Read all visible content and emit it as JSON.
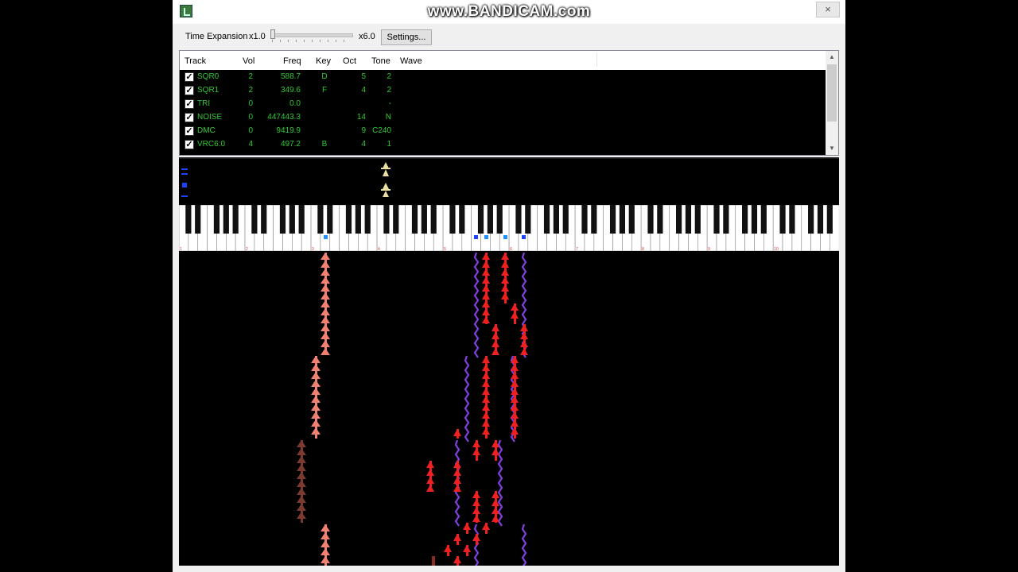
{
  "watermark": "www.BANDICAM.com",
  "window": {
    "close_glyph": "×",
    "icon": "app-note-icon"
  },
  "toolbar": {
    "time_expansion_label": "Time Expansion",
    "min_label": "x1.0",
    "max_label": "x6.0",
    "slider_value": 1.0,
    "settings_label": "Settings..."
  },
  "track_table": {
    "columns": [
      "Track",
      "Vol",
      "Freq",
      "Key",
      "Oct",
      "Tone",
      "Wave"
    ],
    "rows": [
      {
        "checked": true,
        "track": "SQR0",
        "vol": "2",
        "freq": "588.7",
        "key": "D",
        "oct": "5",
        "tone": "2"
      },
      {
        "checked": true,
        "track": "SQR1",
        "vol": "2",
        "freq": "349.6",
        "key": "F",
        "oct": "4",
        "tone": "2"
      },
      {
        "checked": true,
        "track": "TRI",
        "vol": "0",
        "freq": "0.0",
        "key": "",
        "oct": "",
        "tone": "-"
      },
      {
        "checked": true,
        "track": "NOISE",
        "vol": "0",
        "freq": "447443.3",
        "key": "",
        "oct": "14",
        "tone": "N"
      },
      {
        "checked": true,
        "track": "DMC",
        "vol": "0",
        "freq": "9419.9",
        "key": "",
        "oct": "9",
        "tone": "C240"
      },
      {
        "checked": true,
        "track": "VRC6:0",
        "vol": "4",
        "freq": "497.2",
        "key": "B",
        "oct": "4",
        "tone": "1"
      }
    ]
  },
  "colors": {
    "table_text": "#2fc82f",
    "salmon": "#f08070",
    "red": "#f02020",
    "purple": "#8040e0",
    "brown": "#7a3a30",
    "blue_marker": "#1e90ff",
    "yellow_marker": "#e8e0a0"
  },
  "keyboard": {
    "octave_marks": [
      "1",
      "2",
      "3",
      "4",
      "5",
      "6",
      "7",
      "8",
      "9",
      "10"
    ]
  }
}
